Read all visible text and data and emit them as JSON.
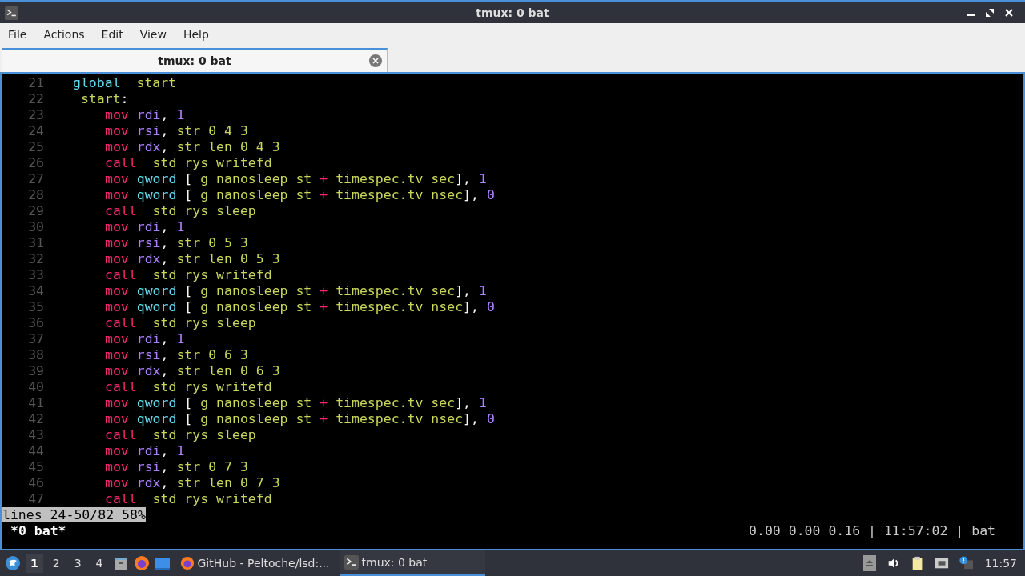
{
  "window": {
    "title": "tmux: 0 bat"
  },
  "menu": [
    "File",
    "Actions",
    "Edit",
    "View",
    "Help"
  ],
  "tabs": [
    {
      "label": "tmux: 0 bat",
      "selected": true
    }
  ],
  "code": [
    {
      "number": "21",
      "kind": "top",
      "tokens": [
        {
          "text": "global ",
          "kind": "dir"
        },
        {
          "text": "_start",
          "kind": "id"
        }
      ]
    },
    {
      "number": "22",
      "kind": "top",
      "tokens": [
        {
          "text": "_start",
          "kind": "id"
        },
        {
          "text": ":",
          "kind": "p"
        }
      ]
    },
    {
      "number": "23",
      "kind": "body",
      "tokens": [
        {
          "text": "mov ",
          "kind": "kw"
        },
        {
          "text": "rdi",
          "kind": "reg"
        },
        {
          "text": ", ",
          "kind": "p"
        },
        {
          "text": "1",
          "kind": "num"
        }
      ]
    },
    {
      "number": "24",
      "kind": "body",
      "tokens": [
        {
          "text": "mov ",
          "kind": "kw"
        },
        {
          "text": "rsi",
          "kind": "reg"
        },
        {
          "text": ", ",
          "kind": "p"
        },
        {
          "text": "str_0_4_3",
          "kind": "id"
        }
      ]
    },
    {
      "number": "25",
      "kind": "body",
      "tokens": [
        {
          "text": "mov ",
          "kind": "kw"
        },
        {
          "text": "rdx",
          "kind": "reg"
        },
        {
          "text": ", ",
          "kind": "p"
        },
        {
          "text": "str_len_0_4_3",
          "kind": "id"
        }
      ]
    },
    {
      "number": "26",
      "kind": "body",
      "tokens": [
        {
          "text": "call ",
          "kind": "kw"
        },
        {
          "text": "_std_rys_writefd",
          "kind": "id"
        }
      ]
    },
    {
      "number": "27",
      "kind": "body",
      "tokens": [
        {
          "text": "mov ",
          "kind": "kw"
        },
        {
          "text": "qword ",
          "kind": "dir"
        },
        {
          "text": "[",
          "kind": "p"
        },
        {
          "text": "_g_nanosleep_st ",
          "kind": "id"
        },
        {
          "text": "+ ",
          "kind": "kw"
        },
        {
          "text": "timespec.tv_sec",
          "kind": "id"
        },
        {
          "text": "], ",
          "kind": "p"
        },
        {
          "text": "1",
          "kind": "num"
        }
      ]
    },
    {
      "number": "28",
      "kind": "body",
      "tokens": [
        {
          "text": "mov ",
          "kind": "kw"
        },
        {
          "text": "qword ",
          "kind": "dir"
        },
        {
          "text": "[",
          "kind": "p"
        },
        {
          "text": "_g_nanosleep_st ",
          "kind": "id"
        },
        {
          "text": "+ ",
          "kind": "kw"
        },
        {
          "text": "timespec.tv_nsec",
          "kind": "id"
        },
        {
          "text": "], ",
          "kind": "p"
        },
        {
          "text": "0",
          "kind": "num"
        }
      ]
    },
    {
      "number": "29",
      "kind": "body",
      "tokens": [
        {
          "text": "call ",
          "kind": "kw"
        },
        {
          "text": "_std_rys_sleep",
          "kind": "id"
        }
      ]
    },
    {
      "number": "30",
      "kind": "body",
      "tokens": [
        {
          "text": "mov ",
          "kind": "kw"
        },
        {
          "text": "rdi",
          "kind": "reg"
        },
        {
          "text": ", ",
          "kind": "p"
        },
        {
          "text": "1",
          "kind": "num"
        }
      ]
    },
    {
      "number": "31",
      "kind": "body",
      "tokens": [
        {
          "text": "mov ",
          "kind": "kw"
        },
        {
          "text": "rsi",
          "kind": "reg"
        },
        {
          "text": ", ",
          "kind": "p"
        },
        {
          "text": "str_0_5_3",
          "kind": "id"
        }
      ]
    },
    {
      "number": "32",
      "kind": "body",
      "tokens": [
        {
          "text": "mov ",
          "kind": "kw"
        },
        {
          "text": "rdx",
          "kind": "reg"
        },
        {
          "text": ", ",
          "kind": "p"
        },
        {
          "text": "str_len_0_5_3",
          "kind": "id"
        }
      ]
    },
    {
      "number": "33",
      "kind": "body",
      "tokens": [
        {
          "text": "call ",
          "kind": "kw"
        },
        {
          "text": "_std_rys_writefd",
          "kind": "id"
        }
      ]
    },
    {
      "number": "34",
      "kind": "body",
      "tokens": [
        {
          "text": "mov ",
          "kind": "kw"
        },
        {
          "text": "qword ",
          "kind": "dir"
        },
        {
          "text": "[",
          "kind": "p"
        },
        {
          "text": "_g_nanosleep_st ",
          "kind": "id"
        },
        {
          "text": "+ ",
          "kind": "kw"
        },
        {
          "text": "timespec.tv_sec",
          "kind": "id"
        },
        {
          "text": "], ",
          "kind": "p"
        },
        {
          "text": "1",
          "kind": "num"
        }
      ]
    },
    {
      "number": "35",
      "kind": "body",
      "tokens": [
        {
          "text": "mov ",
          "kind": "kw"
        },
        {
          "text": "qword ",
          "kind": "dir"
        },
        {
          "text": "[",
          "kind": "p"
        },
        {
          "text": "_g_nanosleep_st ",
          "kind": "id"
        },
        {
          "text": "+ ",
          "kind": "kw"
        },
        {
          "text": "timespec.tv_nsec",
          "kind": "id"
        },
        {
          "text": "], ",
          "kind": "p"
        },
        {
          "text": "0",
          "kind": "num"
        }
      ]
    },
    {
      "number": "36",
      "kind": "body",
      "tokens": [
        {
          "text": "call ",
          "kind": "kw"
        },
        {
          "text": "_std_rys_sleep",
          "kind": "id"
        }
      ]
    },
    {
      "number": "37",
      "kind": "body",
      "tokens": [
        {
          "text": "mov ",
          "kind": "kw"
        },
        {
          "text": "rdi",
          "kind": "reg"
        },
        {
          "text": ", ",
          "kind": "p"
        },
        {
          "text": "1",
          "kind": "num"
        }
      ]
    },
    {
      "number": "38",
      "kind": "body",
      "tokens": [
        {
          "text": "mov ",
          "kind": "kw"
        },
        {
          "text": "rsi",
          "kind": "reg"
        },
        {
          "text": ", ",
          "kind": "p"
        },
        {
          "text": "str_0_6_3",
          "kind": "id"
        }
      ]
    },
    {
      "number": "39",
      "kind": "body",
      "tokens": [
        {
          "text": "mov ",
          "kind": "kw"
        },
        {
          "text": "rdx",
          "kind": "reg"
        },
        {
          "text": ", ",
          "kind": "p"
        },
        {
          "text": "str_len_0_6_3",
          "kind": "id"
        }
      ]
    },
    {
      "number": "40",
      "kind": "body",
      "tokens": [
        {
          "text": "call ",
          "kind": "kw"
        },
        {
          "text": "_std_rys_writefd",
          "kind": "id"
        }
      ]
    },
    {
      "number": "41",
      "kind": "body",
      "tokens": [
        {
          "text": "mov ",
          "kind": "kw"
        },
        {
          "text": "qword ",
          "kind": "dir"
        },
        {
          "text": "[",
          "kind": "p"
        },
        {
          "text": "_g_nanosleep_st ",
          "kind": "id"
        },
        {
          "text": "+ ",
          "kind": "kw"
        },
        {
          "text": "timespec.tv_sec",
          "kind": "id"
        },
        {
          "text": "], ",
          "kind": "p"
        },
        {
          "text": "1",
          "kind": "num"
        }
      ]
    },
    {
      "number": "42",
      "kind": "body",
      "tokens": [
        {
          "text": "mov ",
          "kind": "kw"
        },
        {
          "text": "qword ",
          "kind": "dir"
        },
        {
          "text": "[",
          "kind": "p"
        },
        {
          "text": "_g_nanosleep_st ",
          "kind": "id"
        },
        {
          "text": "+ ",
          "kind": "kw"
        },
        {
          "text": "timespec.tv_nsec",
          "kind": "id"
        },
        {
          "text": "], ",
          "kind": "p"
        },
        {
          "text": "0",
          "kind": "num"
        }
      ]
    },
    {
      "number": "43",
      "kind": "body",
      "tokens": [
        {
          "text": "call ",
          "kind": "kw"
        },
        {
          "text": "_std_rys_sleep",
          "kind": "id"
        }
      ]
    },
    {
      "number": "44",
      "kind": "body",
      "tokens": [
        {
          "text": "mov ",
          "kind": "kw"
        },
        {
          "text": "rdi",
          "kind": "reg"
        },
        {
          "text": ", ",
          "kind": "p"
        },
        {
          "text": "1",
          "kind": "num"
        }
      ]
    },
    {
      "number": "45",
      "kind": "body",
      "tokens": [
        {
          "text": "mov ",
          "kind": "kw"
        },
        {
          "text": "rsi",
          "kind": "reg"
        },
        {
          "text": ", ",
          "kind": "p"
        },
        {
          "text": "str_0_7_3",
          "kind": "id"
        }
      ]
    },
    {
      "number": "46",
      "kind": "body",
      "tokens": [
        {
          "text": "mov ",
          "kind": "kw"
        },
        {
          "text": "rdx",
          "kind": "reg"
        },
        {
          "text": ", ",
          "kind": "p"
        },
        {
          "text": "str_len_0_7_3",
          "kind": "id"
        }
      ]
    },
    {
      "number": "47",
      "kind": "body",
      "tokens": [
        {
          "text": "call ",
          "kind": "kw"
        },
        {
          "text": "_std_rys_writefd",
          "kind": "id"
        }
      ]
    }
  ],
  "pager_status": "lines 24-50/82 58%",
  "tmux_status": {
    "window": "*0 bat*",
    "right": "0.00 0.00 0.16 | 11:57:02 | bat"
  },
  "taskbar": {
    "workspaces": [
      {
        "label": "1",
        "selected": true
      },
      {
        "label": "2",
        "selected": false
      },
      {
        "label": "3",
        "selected": false
      },
      {
        "label": "4",
        "selected": false
      }
    ],
    "tasks": [
      {
        "kind": "browser",
        "label": "GitHub - Peltoche/lsd:...",
        "selected": false
      },
      {
        "kind": "terminal",
        "label": "tmux: 0 bat",
        "selected": true
      }
    ],
    "clock": "11:57"
  }
}
